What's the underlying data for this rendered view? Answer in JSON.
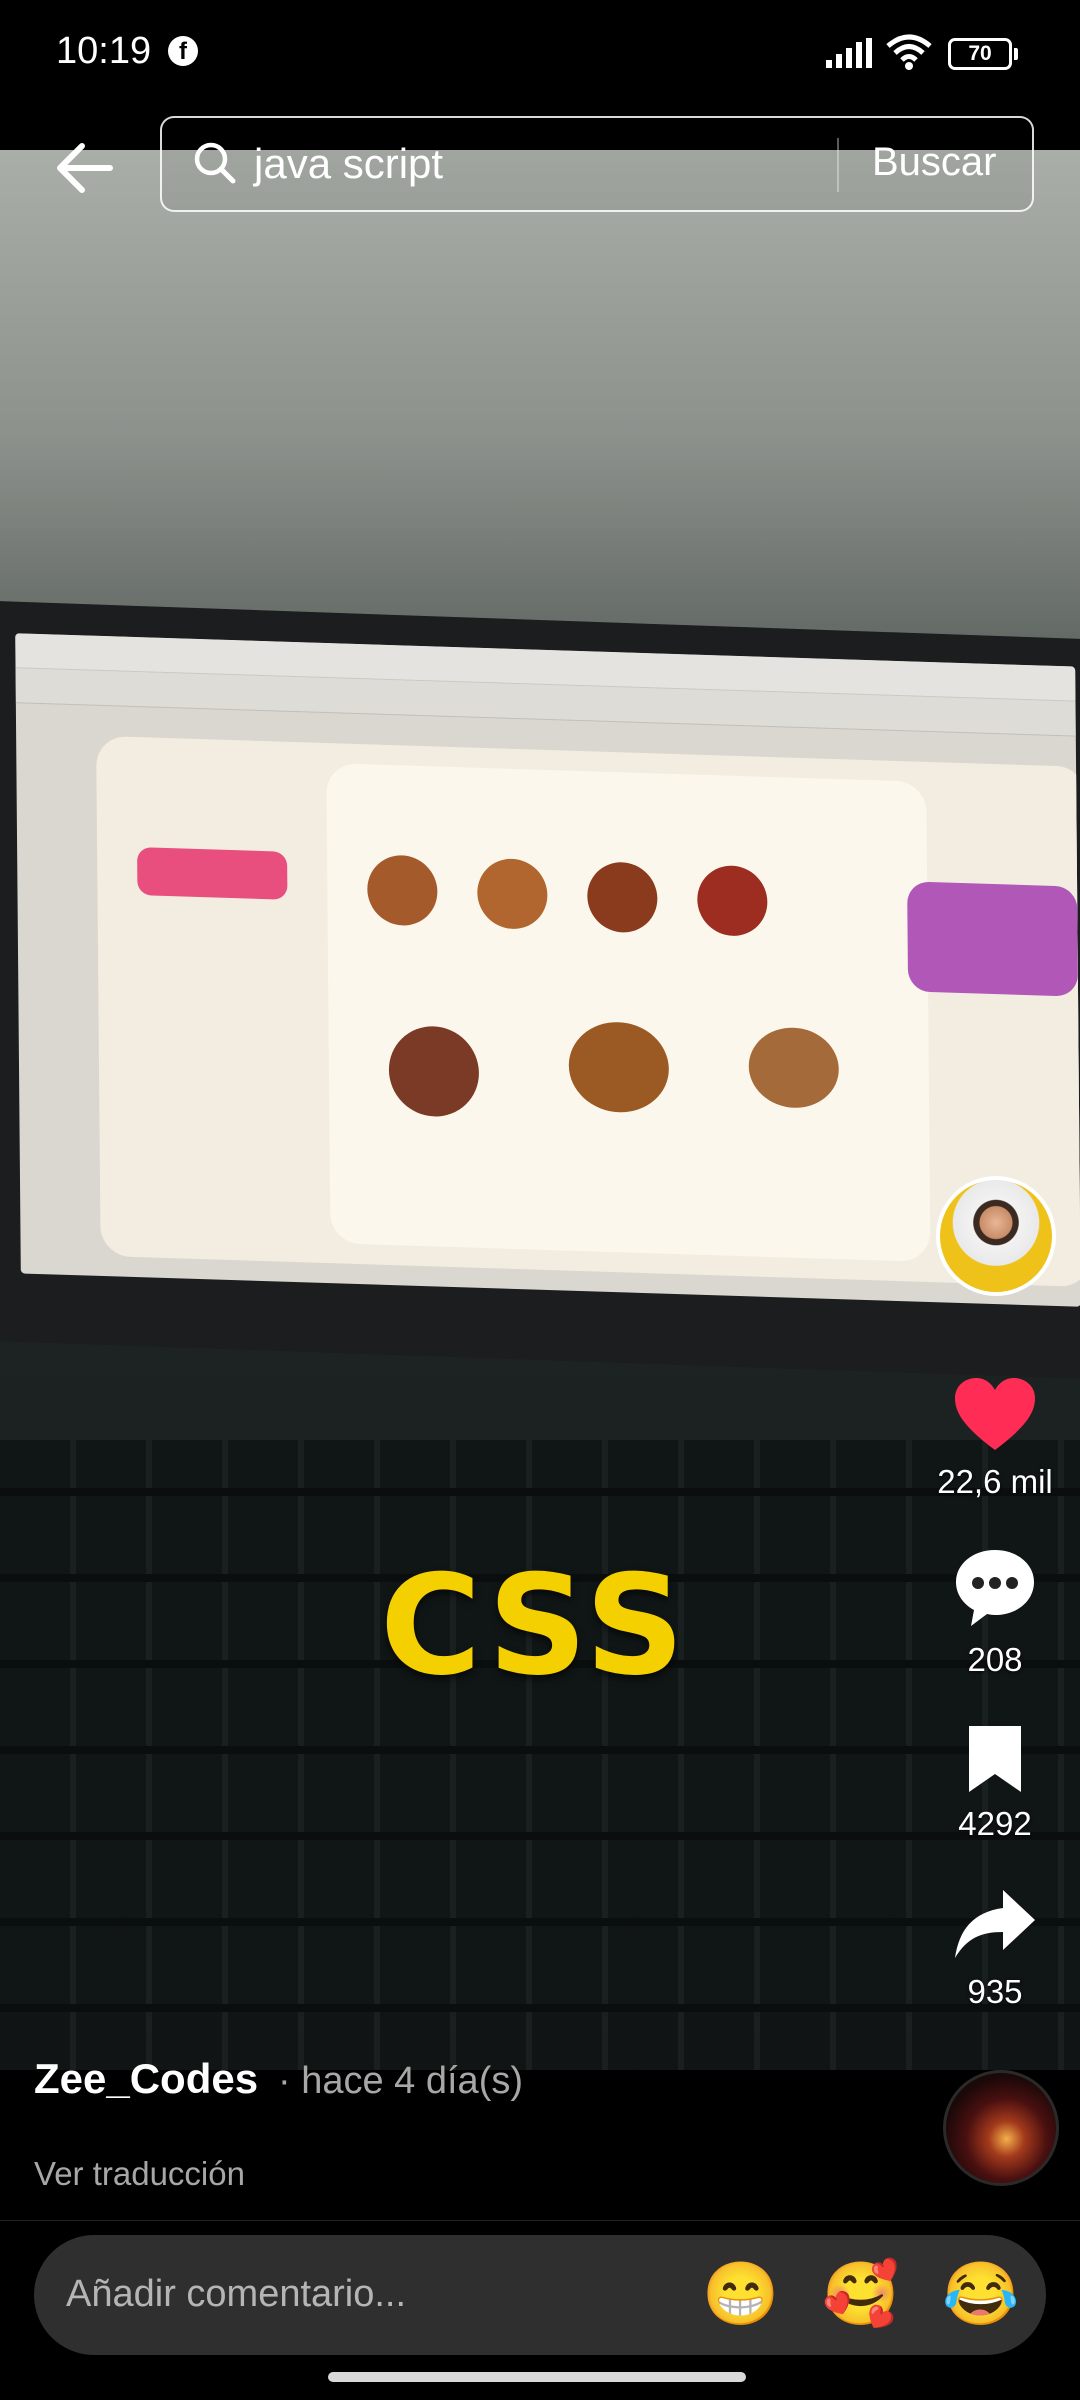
{
  "status_bar": {
    "time": "10:19",
    "battery": "70"
  },
  "search": {
    "query": "java script",
    "button": "Buscar"
  },
  "video": {
    "overlay_text": "CSS"
  },
  "actions": {
    "likes": "22,6 mil",
    "comments": "208",
    "saves": "4292",
    "shares": "935"
  },
  "caption": {
    "author": "Zee_Codes",
    "time": "· hace 4 día(s)",
    "translate": "Ver traducción"
  },
  "comment": {
    "placeholder": "Añadir comentario...",
    "emojis": [
      "😁",
      "🥰",
      "😂"
    ]
  },
  "colors": {
    "like": "#ff2d55",
    "overlay": "#f5d000"
  }
}
